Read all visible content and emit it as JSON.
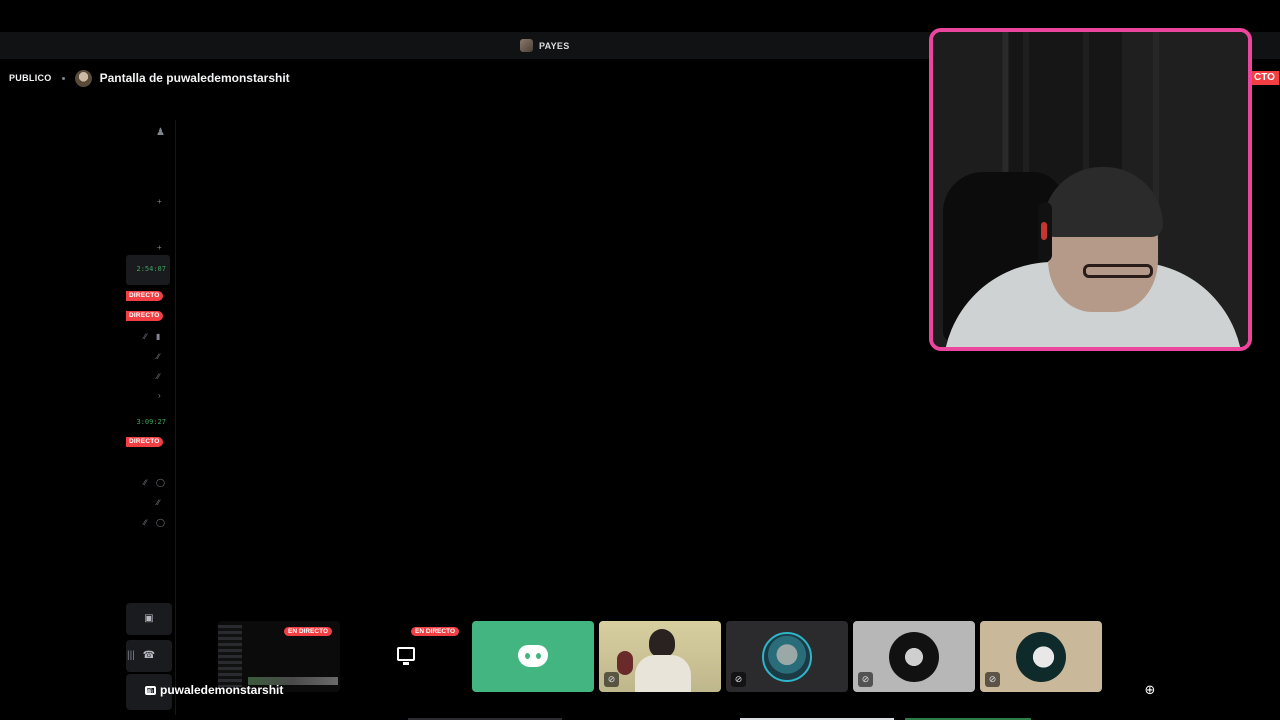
{
  "server": {
    "name": "PAYES"
  },
  "stream": {
    "visibility": "PUBLICO",
    "title": "Pantalla de puwaledemonstarshit",
    "live_corner": "CTO",
    "streamer": "puwaledemonstarshit"
  },
  "sidebar": {
    "timers": [
      "2:54:07",
      "3:09:27"
    ],
    "live_badges": [
      "DIRECTO",
      "DIRECTO",
      "DIRECTO"
    ]
  },
  "tiles": {
    "live_label": "EN DIRECTO"
  },
  "colors": {
    "accent_pink": "#eb459e",
    "live_red": "#f23f43",
    "discord_green": "#43b581",
    "timer_green": "#3ba55d"
  },
  "icons": {
    "add_person": "add-person-icon",
    "screen": "screen-icon",
    "discord": "discord-logo-icon",
    "mute": "mic-muted-icon",
    "zoom": "zoom-in-icon"
  }
}
